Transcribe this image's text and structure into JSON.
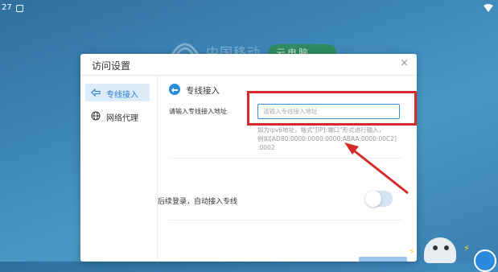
{
  "status_bar": {
    "time": "27"
  },
  "background": {
    "brand_text": "中国移动",
    "badge_text": "云电脑"
  },
  "dialog": {
    "title": "访问设置",
    "close_label": "×"
  },
  "sidebar": {
    "items": [
      {
        "label": "专线接入",
        "icon": "dedicated-line-icon",
        "active": true
      },
      {
        "label": "网络代理",
        "icon": "globe-icon",
        "active": false
      }
    ]
  },
  "section": {
    "title": "专线接入",
    "field_label": "请输入专线接入地址",
    "input_placeholder": "请输入专线接入地址",
    "input_value": "",
    "hint_lines": [
      "如为ipv6地址，格式\"[IP]:端口\"形式进行输入，",
      "例如[AD80:0000:0000:0000:ABAA:0000:00C2]",
      ":0002"
    ],
    "toggle_label": "后续登录，自动接入专线",
    "toggle_on": false
  },
  "colors": {
    "accent": "#2a8bdc",
    "highlight": "#d42a2a"
  }
}
